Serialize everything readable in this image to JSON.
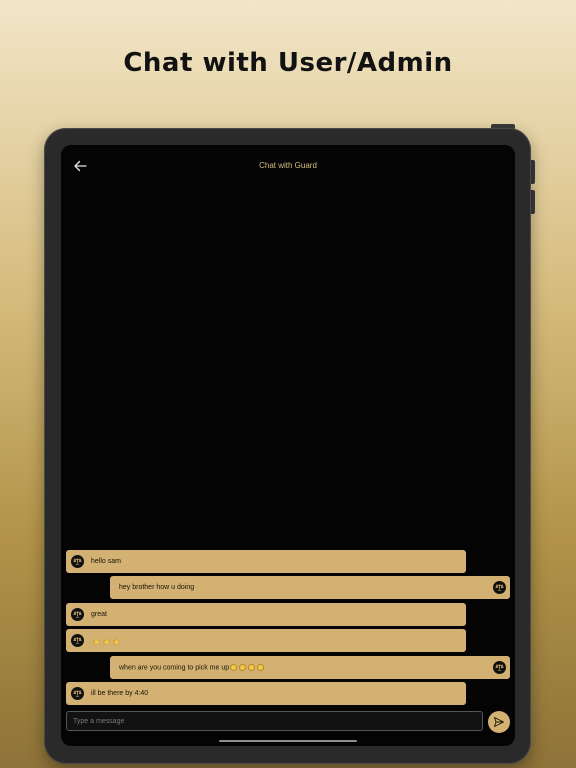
{
  "page": {
    "headline": "Chat with User/Admin"
  },
  "chat": {
    "title": "Chat with Guard",
    "back_icon": "arrow-left-icon",
    "avatar_icon": "gavel-icon",
    "messages": [
      {
        "side": "left",
        "text": "hello sam"
      },
      {
        "side": "right",
        "text": "hey brother how u doing"
      },
      {
        "side": "left",
        "text": "great"
      },
      {
        "side": "left",
        "text": "",
        "emoji": "thumbs-up x3"
      },
      {
        "side": "right",
        "text": "when are you coming to pick me up",
        "emoji": "smiling-face x4"
      },
      {
        "side": "left",
        "text": "ill be there by 4:40"
      }
    ]
  },
  "composer": {
    "placeholder": "Type a message",
    "value": "",
    "send_icon": "send-icon"
  },
  "colors": {
    "accent": "#d3b172",
    "screen_background": "#040404",
    "title_text": "#d9be84"
  }
}
